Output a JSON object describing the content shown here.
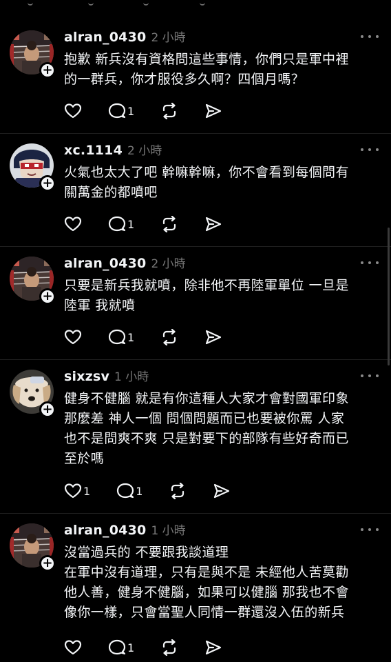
{
  "posts": [
    {
      "username": "alran_0430",
      "time": "2 小時",
      "text": "抱歉 新兵沒有資格問這些事情，你們只是軍中裡\n的一群兵，你才服役多久啊？四個月嗎？",
      "likes": "",
      "replies": "1",
      "avatar": "boxing-ring-photo"
    },
    {
      "username": "xc.1114",
      "time": "2 小時",
      "text": "火氣也太大了吧 幹嘛幹嘛，你不會看到每個問有\n關萬金的都噴吧",
      "likes": "",
      "replies": "1",
      "avatar": "anime-character"
    },
    {
      "username": "alran_0430",
      "time": "2 小時",
      "text": "只要是新兵我就噴，除非他不再陸軍單位 一旦是\n陸軍 我就噴",
      "likes": "",
      "replies": "1",
      "avatar": "boxing-ring-photo"
    },
    {
      "username": "sixzsv",
      "time": "1 小時",
      "text": "健身不健腦 就是有你這種人大家才會對國軍印象\n那麼差 神人一個 問個問題而已也要被你罵 人家\n也不是問爽不爽 只是對要下的部隊有些好奇而已\n至於嗎",
      "likes": "1",
      "replies": "1",
      "avatar": "dog-photo"
    },
    {
      "username": "alran_0430",
      "time": "1 小時",
      "text": "沒當過兵的 不要跟我談道理\n在軍中沒有道理，只有是與不是 未經他人苦莫勸\n他人善，健身不健腦，如果可以健腦 那我也不會\n像你一樣，只會當聖人同情一群還沒入伍的新兵",
      "likes": "",
      "replies": "1",
      "avatar": "boxing-ring-photo"
    }
  ],
  "icons": {
    "like": "heart-icon",
    "reply": "speech-bubble-icon",
    "repost": "repost-icon",
    "share": "send-icon",
    "more": "more-dots-icon",
    "follow": "plus-icon"
  },
  "colors": {
    "background": "#000000",
    "text": "#f3f5f7",
    "muted": "#777777"
  }
}
